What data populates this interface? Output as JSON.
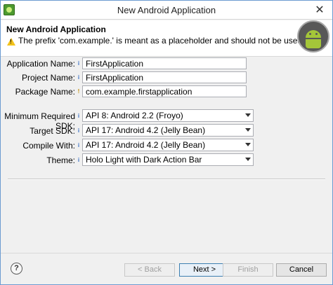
{
  "window": {
    "title": "New Android Application"
  },
  "header": {
    "title": "New Android Application",
    "message": "The prefix 'com.example.' is meant as a placeholder and should not be used"
  },
  "form": {
    "application_name": {
      "label": "Application Name:",
      "value": "FirstApplication"
    },
    "project_name": {
      "label": "Project Name:",
      "value": "FirstApplication"
    },
    "package_name": {
      "label": "Package Name:",
      "value": "com.example.firstapplication"
    },
    "min_sdk": {
      "label": "Minimum Required SDK:",
      "value": "API 8: Android 2.2 (Froyo)"
    },
    "target_sdk": {
      "label": "Target SDK:",
      "value": "API 17: Android 4.2 (Jelly Bean)"
    },
    "compile_with": {
      "label": "Compile With:",
      "value": "API 17: Android 4.2 (Jelly Bean)"
    },
    "theme": {
      "label": "Theme:",
      "value": "Holo Light with Dark Action Bar"
    }
  },
  "buttons": {
    "help": "?",
    "back": "< Back",
    "next": "Next >",
    "finish": "Finish",
    "cancel": "Cancel"
  },
  "icons": {
    "warning": "warning-icon",
    "info": "info-icon",
    "banner": "android-banner-icon"
  },
  "colors": {
    "android_green": "#a4c639",
    "warning_yellow": "#f2c21b"
  }
}
